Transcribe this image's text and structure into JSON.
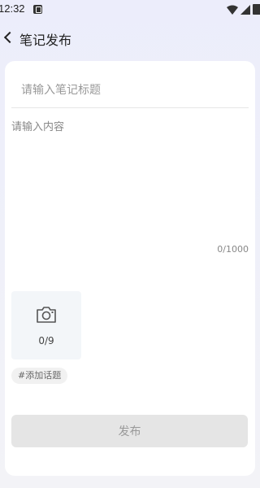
{
  "status_bar": {
    "time": "12:32"
  },
  "header": {
    "title": "笔记发布"
  },
  "form": {
    "title_placeholder": "请输入笔记标题",
    "content_placeholder": "请输入内容",
    "char_count": "0/1000",
    "photo_count": "0/9",
    "topic_tag": "#添加话题",
    "publish_label": "发布"
  },
  "icons": [
    "notification-icon",
    "wifi-icon",
    "signal-icon",
    "battery-icon",
    "back-icon",
    "camera-icon"
  ]
}
